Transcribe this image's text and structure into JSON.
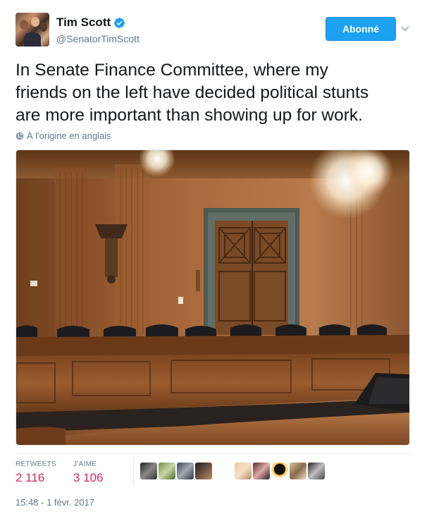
{
  "author": {
    "display_name": "Tim Scott",
    "handle": "@SenatorTimScott",
    "verified": true,
    "avatar_icon": "profile-photo",
    "verified_icon": "verified-badge-icon"
  },
  "follow_button": {
    "label": "Abonné"
  },
  "menu_icon": "chevron-down-icon",
  "tweet": {
    "text": "In Senate Finance Committee, where my\nfriends on the left have decided political stunts\nare more important than showing up for work.",
    "translate_label": "À l'origine en anglais",
    "translate_icon": "globe-icon"
  },
  "media": {
    "description_icon": "photo"
  },
  "stats": {
    "retweets_label": "RETWEETS",
    "retweets_value": "2 116",
    "likes_label": "J'AIME",
    "likes_value": "3 106"
  },
  "likers": [
    {
      "icon": "liker-avatar"
    },
    {
      "icon": "liker-avatar"
    },
    {
      "icon": "liker-avatar"
    },
    {
      "icon": "liker-avatar"
    },
    {
      "icon": "liker-avatar"
    },
    {
      "icon": "liker-avatar"
    },
    {
      "icon": "liker-avatar"
    },
    {
      "icon": "liker-avatar"
    },
    {
      "icon": "liker-avatar"
    },
    {
      "icon": "liker-avatar"
    }
  ],
  "timestamp": "15:48 - 1 févr. 2017",
  "colors": {
    "accent": "#1da1f2",
    "like": "#e0245e",
    "muted": "#657786"
  }
}
